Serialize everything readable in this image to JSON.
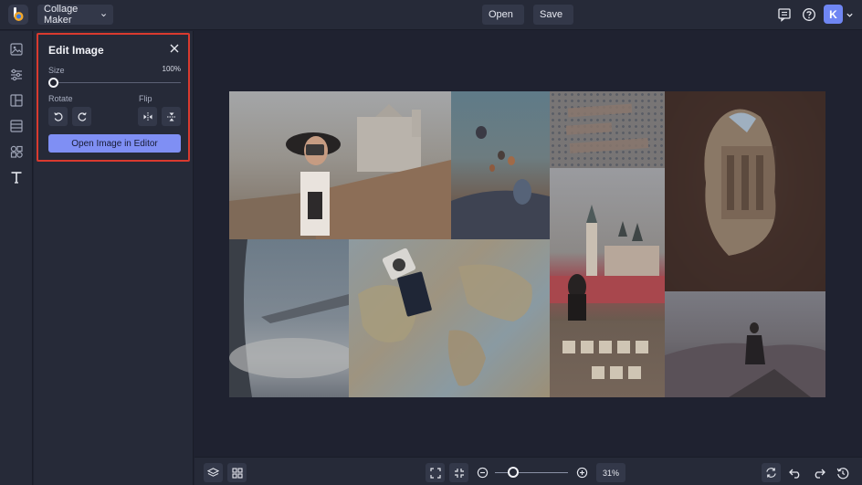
{
  "header": {
    "app_dropdown_label": "Collage Maker",
    "open_label": "Open",
    "save_label": "Save",
    "avatar_initial": "K"
  },
  "rail": {
    "items": [
      "image-icon",
      "adjustments-icon",
      "layout-icon",
      "spacing-icon",
      "graphics-icon",
      "text-icon"
    ]
  },
  "edit_panel": {
    "title": "Edit Image",
    "size_label": "Size",
    "size_value": "100%",
    "size_fraction": 0.0,
    "rotate_label": "Rotate",
    "flip_label": "Flip",
    "open_editor_label": "Open Image in Editor"
  },
  "footer": {
    "zoom_value": "31%",
    "zoom_fraction": 0.2
  },
  "collage": {
    "tiles": [
      {
        "name": "photo-woman-camera",
        "bg": "#8f8172"
      },
      {
        "name": "photo-balloons",
        "bg": "#5c6470"
      },
      {
        "name": "photo-dotted-text",
        "bg": "#6f6b6a"
      },
      {
        "name": "photo-petra-cave",
        "bg": "#4a3a34"
      },
      {
        "name": "photo-prague",
        "bg": "#7c6f6f"
      },
      {
        "name": "photo-airplane-wing",
        "bg": "#6f7a86"
      },
      {
        "name": "photo-world-map-passport",
        "bg": "#8d8878"
      },
      {
        "name": "photo-dream-big-tiles",
        "bg": "#6a5a4d"
      },
      {
        "name": "photo-woman-mountain",
        "bg": "#5d5a5e"
      }
    ]
  }
}
